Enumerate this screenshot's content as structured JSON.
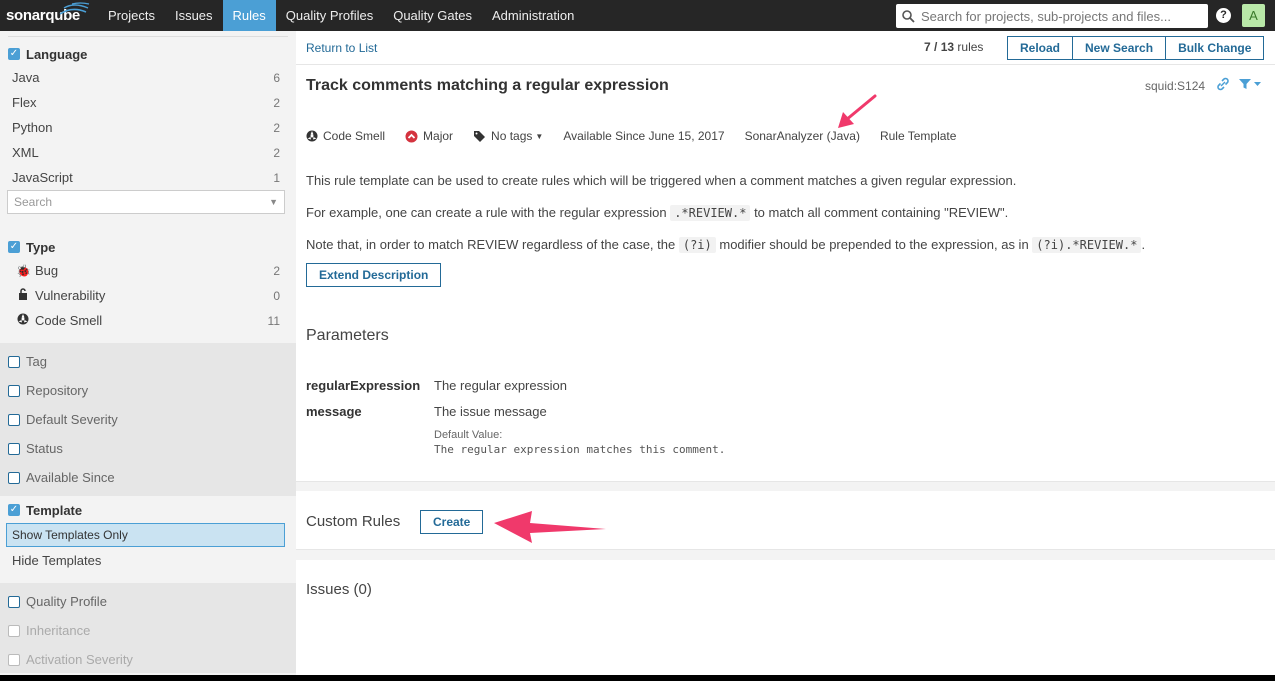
{
  "nav": {
    "logo": "sonarqube",
    "items": [
      "Projects",
      "Issues",
      "Rules",
      "Quality Profiles",
      "Quality Gates",
      "Administration"
    ],
    "active": "Rules",
    "search_placeholder": "Search for projects, sub-projects and files...",
    "help": "?",
    "avatar": "A"
  },
  "sidebar": {
    "language": {
      "title": "Language",
      "items": [
        {
          "label": "Java",
          "count": "6"
        },
        {
          "label": "Flex",
          "count": "2"
        },
        {
          "label": "Python",
          "count": "2"
        },
        {
          "label": "XML",
          "count": "2"
        },
        {
          "label": "JavaScript",
          "count": "1"
        }
      ],
      "search_placeholder": "Search"
    },
    "type": {
      "title": "Type",
      "items": [
        {
          "label": "Bug",
          "count": "2",
          "icon": "bug-icon"
        },
        {
          "label": "Vulnerability",
          "count": "0",
          "icon": "lock-icon"
        },
        {
          "label": "Code Smell",
          "count": "11",
          "icon": "code-smell-icon"
        }
      ]
    },
    "closed_facets": [
      "Tag",
      "Repository",
      "Default Severity",
      "Status",
      "Available Since"
    ],
    "template": {
      "title": "Template",
      "items": [
        "Show Templates Only",
        "Hide Templates"
      ],
      "selected": "Show Templates Only"
    },
    "more_facets": [
      "Quality Profile",
      "Inheritance",
      "Activation Severity"
    ]
  },
  "topbar": {
    "return": "Return to List",
    "paging_current": "7",
    "paging_sep": " / ",
    "paging_total": "13",
    "paging_suffix": " rules",
    "buttons": [
      "Reload",
      "New Search",
      "Bulk Change"
    ]
  },
  "rule": {
    "title": "Track comments matching a regular expression",
    "key": "squid:S124",
    "meta": {
      "type": "Code Smell",
      "severity": "Major",
      "tags": "No tags",
      "available": "Available Since June 15, 2017",
      "repository": "SonarAnalyzer (Java)",
      "template": "Rule Template"
    },
    "desc1": "This rule template can be used to create rules which will be triggered when a comment matches a given regular expression.",
    "desc2_pre": "For example, one can create a rule with the regular expression ",
    "desc2_code": ".*REVIEW.*",
    "desc2_post": " to match all comment containing \"REVIEW\".",
    "desc3_pre": "Note that, in order to match REVIEW regardless of the case, the ",
    "desc3_code1": "(?i)",
    "desc3_mid": " modifier should be prepended to the expression, as in ",
    "desc3_code2": "(?i).*REVIEW.*",
    "desc3_post": ".",
    "extend_button": "Extend Description"
  },
  "parameters": {
    "title": "Parameters",
    "items": [
      {
        "key": "regularExpression",
        "desc": "The regular expression"
      },
      {
        "key": "message",
        "desc": "The issue message"
      }
    ],
    "default_label": "Default Value:",
    "default_value": "The regular expression matches this comment."
  },
  "custom_rules": {
    "title": "Custom Rules",
    "create": "Create"
  },
  "issues": {
    "title": "Issues (0)"
  },
  "colors": {
    "accent": "#4b9fd5",
    "link": "#236a97",
    "annotation_arrow": "#f0396b"
  }
}
